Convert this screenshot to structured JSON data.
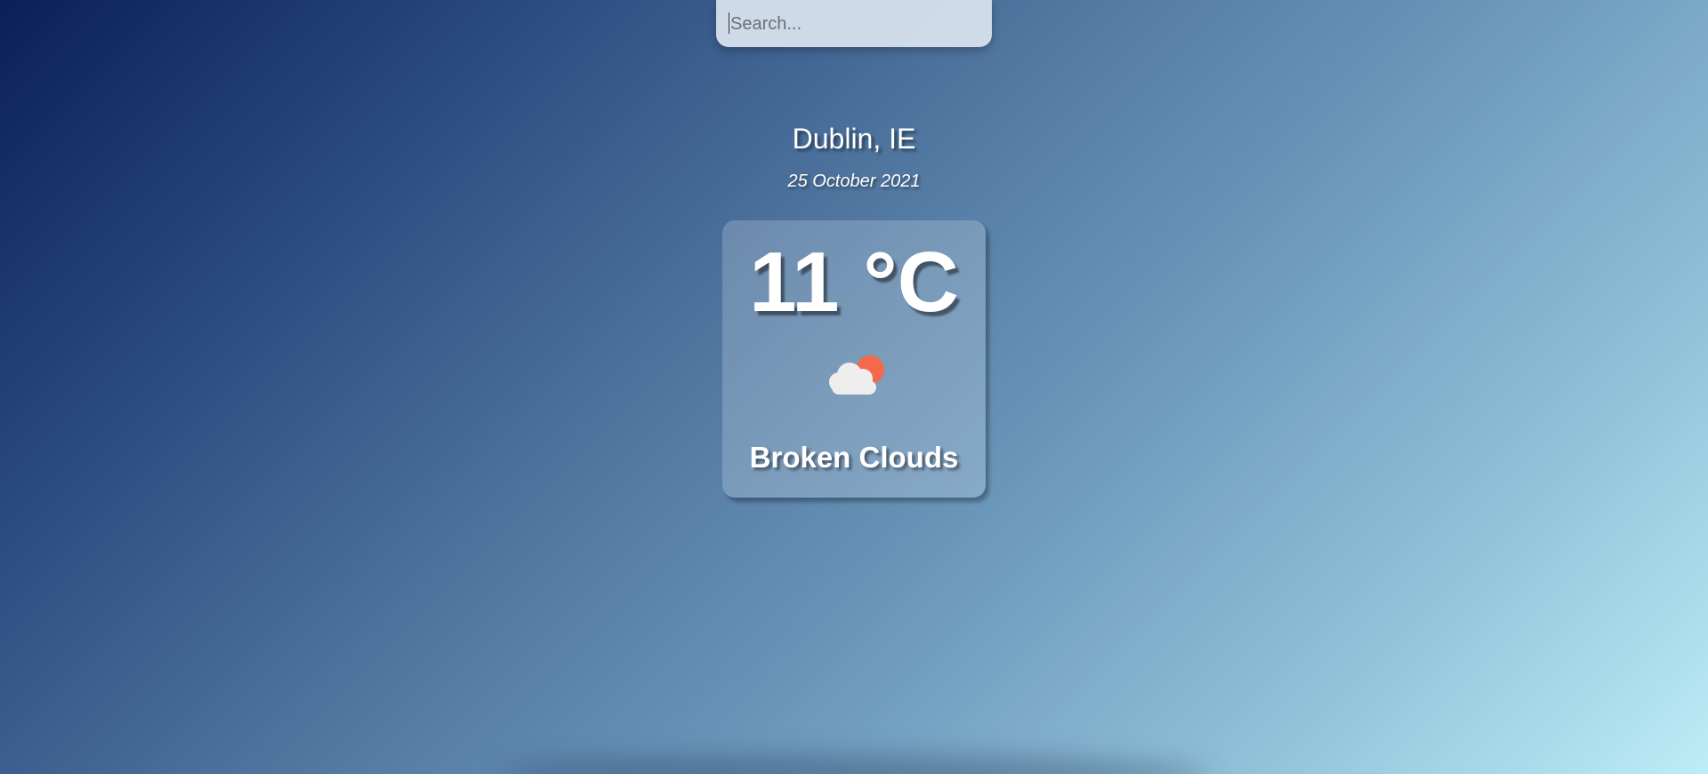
{
  "search": {
    "placeholder": "Search...",
    "value": ""
  },
  "location": {
    "city_country": "Dublin, IE",
    "date": "25 October 2021"
  },
  "weather": {
    "temperature": "11 °C",
    "condition": "Broken Clouds",
    "icon": "cloud-sun-icon"
  },
  "colors": {
    "background_start": "#0b1f57",
    "background_end": "#bcedf7",
    "sun": "#f26a4b",
    "cloud": "#eeeeee"
  }
}
